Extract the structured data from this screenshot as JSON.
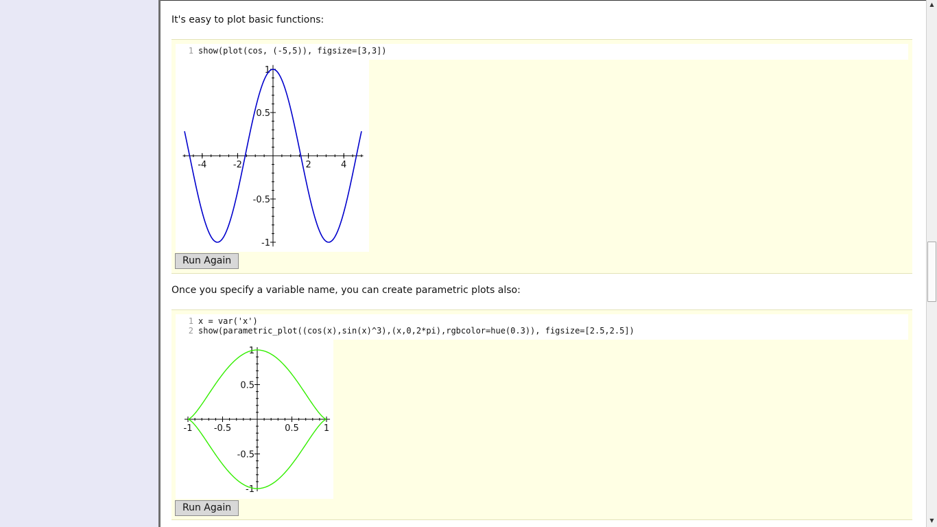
{
  "section1": {
    "intro": "It's easy to plot basic functions:",
    "code": [
      {
        "n": "1",
        "text": "show(plot(cos, (-5,5)), figsize=[3,3])"
      }
    ],
    "run_label": "Run Again"
  },
  "section2": {
    "intro": "Once you specify a variable name, you can create parametric plots also:",
    "code": [
      {
        "n": "1",
        "text": "x = var('x')"
      },
      {
        "n": "2",
        "text": "show(parametric_plot((cos(x),sin(x)^3),(x,0,2*pi),rgbcolor=hue(0.3)), figsize=[2.5,2.5])"
      }
    ],
    "run_label": "Run Again"
  },
  "chart_data": [
    {
      "type": "line",
      "function": "cos(x)",
      "xlim": [
        -5,
        5
      ],
      "ylim": [
        -1,
        1
      ],
      "x_ticks": [
        "-4",
        "-2",
        "2",
        "4"
      ],
      "y_ticks": [
        "1",
        "0.5",
        "-0.5",
        "-1"
      ],
      "color": "#0000cc",
      "series": [
        {
          "x": [
            -5,
            -4.5,
            -4,
            -3.5,
            -3,
            -2.5,
            -2,
            -1.5,
            -1,
            -0.5,
            0,
            0.5,
            1,
            1.5,
            2,
            2.5,
            3,
            3.5,
            4,
            4.5,
            5
          ],
          "y": [
            0.284,
            -0.211,
            -0.654,
            -0.936,
            -0.99,
            -0.801,
            -0.416,
            0.071,
            0.54,
            0.878,
            1.0,
            0.878,
            0.54,
            0.071,
            -0.416,
            -0.801,
            -0.99,
            -0.936,
            -0.654,
            -0.211,
            0.284
          ]
        }
      ]
    },
    {
      "type": "line",
      "function": "(cos(t), sin(t)^3), t in [0, 2pi]",
      "xlim": [
        -1,
        1
      ],
      "ylim": [
        -1,
        1
      ],
      "x_ticks": [
        "-1",
        "-0.5",
        "0.5",
        "1"
      ],
      "y_ticks": [
        "1",
        "0.5",
        "-0.5",
        "-1"
      ],
      "color": "#33ee00",
      "series": [
        {
          "x": [
            1,
            0.924,
            0.707,
            0.383,
            0,
            -0.383,
            -0.707,
            -0.924,
            -1,
            -0.924,
            -0.707,
            -0.383,
            0,
            0.383,
            0.707,
            0.924,
            1
          ],
          "y": [
            0,
            0.056,
            0.354,
            0.789,
            1,
            0.789,
            0.354,
            0.056,
            0,
            -0.056,
            -0.354,
            -0.789,
            -1,
            -0.789,
            -0.354,
            -0.056,
            0
          ]
        }
      ]
    }
  ]
}
